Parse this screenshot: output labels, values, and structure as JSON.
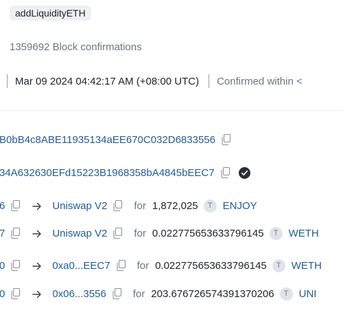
{
  "method": "addLiquidityETH",
  "block_confirmations": "1359692 Block confirmations",
  "timestamp": "Mar 09 2024 04:42:17 AM (+08:00 UTC)",
  "confirmed_within": "Confirmed within <",
  "from_address": "B0bB4c8ABE11935134aEE670C032D6833556",
  "to_address": "34A632630EFd15223B1968358bA4845bEEC7",
  "transfers": [
    {
      "from": "6",
      "to": "Uniswap V2",
      "for_label": "for",
      "amount": "1,872,025",
      "token_icon": "T",
      "token": "ENJOY"
    },
    {
      "from": "7",
      "to": "Uniswap V2",
      "for_label": "for",
      "amount": "0.022775653633796145",
      "token_icon": "T",
      "token": "WETH"
    },
    {
      "from": "0",
      "to": "0xa0...EEC7",
      "for_label": "for",
      "amount": "0.022775653633796145",
      "token_icon": "T",
      "token": "WETH"
    },
    {
      "from": "0",
      "to": "0x06...3556",
      "for_label": "for",
      "amount": "203.676726574391370206",
      "token_icon": "T",
      "token": "UNI"
    }
  ]
}
